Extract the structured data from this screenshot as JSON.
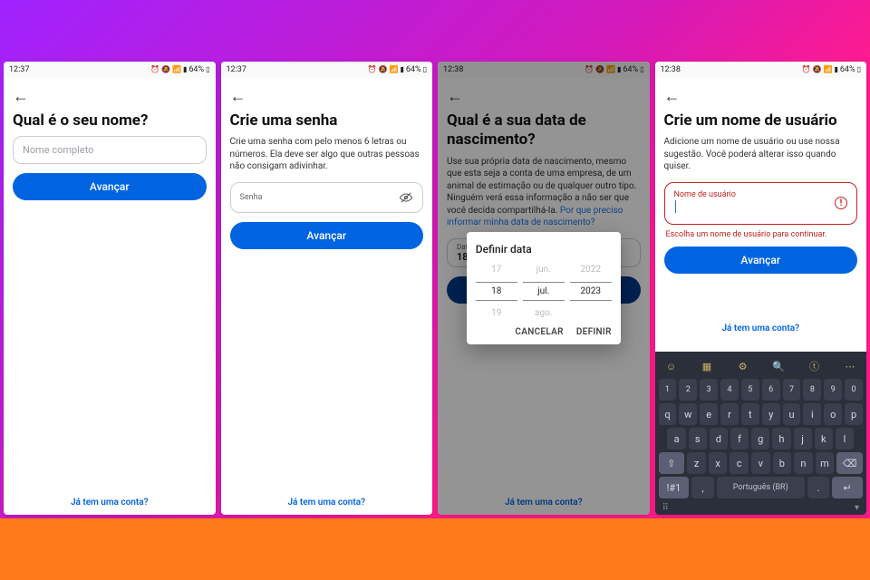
{
  "status": {
    "time1": "12:37",
    "time2": "12:38",
    "battery": "64%"
  },
  "common": {
    "advance": "Avançar",
    "already": "Já tem uma conta?",
    "back": "←"
  },
  "screen1": {
    "title": "Qual é o seu nome?",
    "placeholder": "Nome completo"
  },
  "screen2": {
    "title": "Crie uma senha",
    "sub": "Crie uma senha com pelo menos 6 letras ou números. Ela deve ser algo que outras pessoas não consigam adivinhar.",
    "field_label": "Senha"
  },
  "screen3": {
    "title": "Qual é a sua data de nascimento?",
    "sub_a": "Use sua própria data de nascimento, mesmo que esta seja a conta de uma empresa, de um animal de estimação ou de qualquer outro tipo. Ninguém verá essa informação a não ser que você decida compartilhá-la.",
    "sub_link": "Por que preciso informar minha data de nascimento?",
    "date_label": "Data de",
    "date_value": "18 de",
    "dialog": {
      "title": "Definir data",
      "days": [
        "17",
        "18",
        "19"
      ],
      "months": [
        "jun.",
        "jul.",
        "ago."
      ],
      "years": [
        "2022",
        "2023",
        ""
      ],
      "cancel": "CANCELAR",
      "set": "DEFINIR"
    }
  },
  "screen4": {
    "title": "Crie um nome de usuário",
    "sub": "Adicione um nome de usuário ou use nossa sugestão. Você poderá alterar isso quando quiser.",
    "field_label": "Nome de usuário",
    "error": "Escolha um nome de usuário para continuar."
  },
  "keyboard": {
    "nums": [
      "1",
      "2",
      "3",
      "4",
      "5",
      "6",
      "7",
      "8",
      "9",
      "0"
    ],
    "row1": [
      "q",
      "w",
      "e",
      "r",
      "t",
      "y",
      "u",
      "i",
      "o",
      "p"
    ],
    "row2": [
      "a",
      "s",
      "d",
      "f",
      "g",
      "h",
      "j",
      "k",
      "l"
    ],
    "row3": [
      "z",
      "x",
      "c",
      "v",
      "b",
      "n",
      "m"
    ],
    "shift": "⇧",
    "back": "⌫",
    "sym": "!#1",
    "lang": "Português (BR)",
    "comma": ",",
    "dot": ".",
    "enter": "↵"
  }
}
